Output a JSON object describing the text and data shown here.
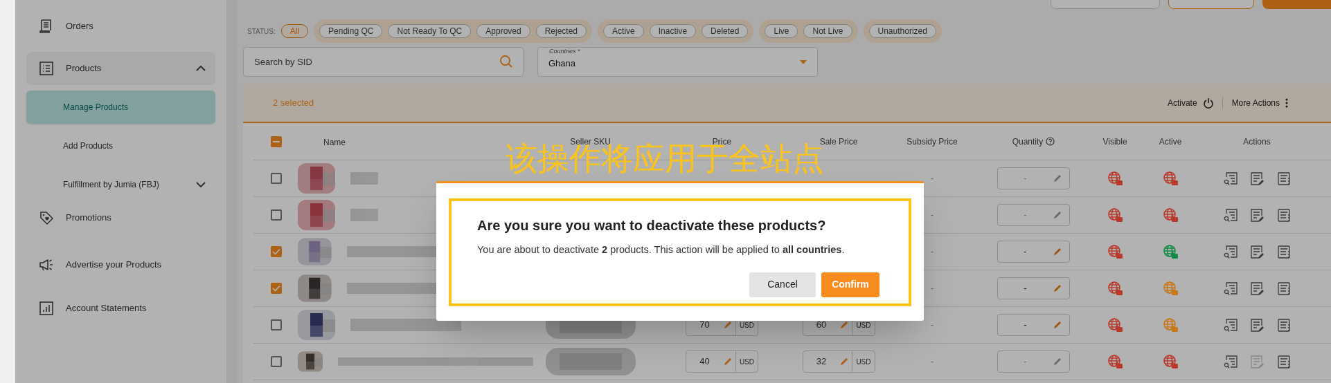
{
  "sidebar": {
    "items": [
      {
        "label": "Orders",
        "selected": false
      },
      {
        "label": "Products",
        "selected": false,
        "expanded": true,
        "children": [
          {
            "label": "Manage Products",
            "selected": true
          },
          {
            "label": "Add Products",
            "selected": false
          },
          {
            "label": "Fulfillment by Jumia (FBJ)",
            "selected": false,
            "expanded": false
          }
        ]
      },
      {
        "label": "Promotions",
        "selected": false
      },
      {
        "label": "Advertise your Products",
        "selected": false
      },
      {
        "label": "Account Statements",
        "selected": false
      }
    ]
  },
  "status_filter": {
    "label": "STATUS:",
    "groups": [
      [
        {
          "label": "All",
          "selected": true
        }
      ],
      [
        {
          "label": "Pending QC",
          "selected": false
        },
        {
          "label": "Not Ready To QC",
          "selected": false
        },
        {
          "label": "Approved",
          "selected": false
        },
        {
          "label": "Rejected",
          "selected": false
        }
      ],
      [
        {
          "label": "Active",
          "selected": false
        },
        {
          "label": "Inactive",
          "selected": false
        },
        {
          "label": "Deleted",
          "selected": false
        }
      ],
      [
        {
          "label": "Live",
          "selected": false
        },
        {
          "label": "Not Live",
          "selected": false
        }
      ],
      [
        {
          "label": "Unauthorized",
          "selected": false
        }
      ]
    ]
  },
  "search": {
    "placeholder": "Search by SID"
  },
  "countries": {
    "label": "Countries *",
    "value": "Ghana"
  },
  "selection_bar": {
    "count": "2 selected",
    "actions": [
      "Activate",
      "More Actions"
    ]
  },
  "table": {
    "indeterminate": true,
    "columns": [
      "Name",
      "Seller SKU",
      "Price",
      "Sale Price",
      "Subsidy Price",
      "Quantity",
      "Visible",
      "Active",
      "Actions"
    ],
    "rows": [
      {
        "checked": false,
        "subsidy": "-",
        "quantity": "-",
        "quantity_editable": false,
        "visible": {
          "color": "#b93a2c"
        },
        "active": {
          "color": "#b93a2c"
        },
        "edit_disabled": false
      },
      {
        "checked": false,
        "subsidy": "-",
        "quantity": "-",
        "quantity_editable": false,
        "visible": {
          "color": "#b93a2c"
        },
        "active": {
          "color": "#b93a2c"
        },
        "edit_disabled": false
      },
      {
        "checked": true,
        "subsidy": "-",
        "quantity": "-",
        "quantity_editable": true,
        "visible": {
          "color": "#b93a2c"
        },
        "active": {
          "color": "#138a48"
        },
        "edit_disabled": false
      },
      {
        "checked": true,
        "subsidy": "-",
        "quantity": "-",
        "quantity_editable": true,
        "visible": {
          "color": "#b93a2c"
        },
        "active": {
          "color": "#c7791a"
        },
        "edit_disabled": false
      },
      {
        "checked": false,
        "price": "70",
        "price_currency": "USD",
        "sale_price": "60",
        "sale_currency": "USD",
        "subsidy": "-",
        "quantity": "-",
        "quantity_editable": true,
        "visible": {
          "color": "#b93a2c"
        },
        "active": {
          "color": "#c7791a"
        },
        "edit_disabled": false
      },
      {
        "checked": false,
        "price": "40",
        "price_currency": "USD",
        "sale_price": "32",
        "sale_currency": "USD",
        "subsidy": "-",
        "quantity": "-",
        "quantity_editable": false,
        "visible": {
          "color": "#b93a2c"
        },
        "active": {
          "color": "#b93a2c"
        },
        "edit_disabled": true
      }
    ]
  },
  "dialog": {
    "title": "Are you sure you want to deactivate these products?",
    "message": "You are about to deactivate **2** products. This action will be applied to **all countries**.",
    "buttons": [
      {
        "label": "Cancel",
        "kind": "secondary"
      },
      {
        "label": "Confirm",
        "kind": "primary"
      }
    ]
  },
  "annotation": {
    "text": "该操作将应用于全站点"
  }
}
